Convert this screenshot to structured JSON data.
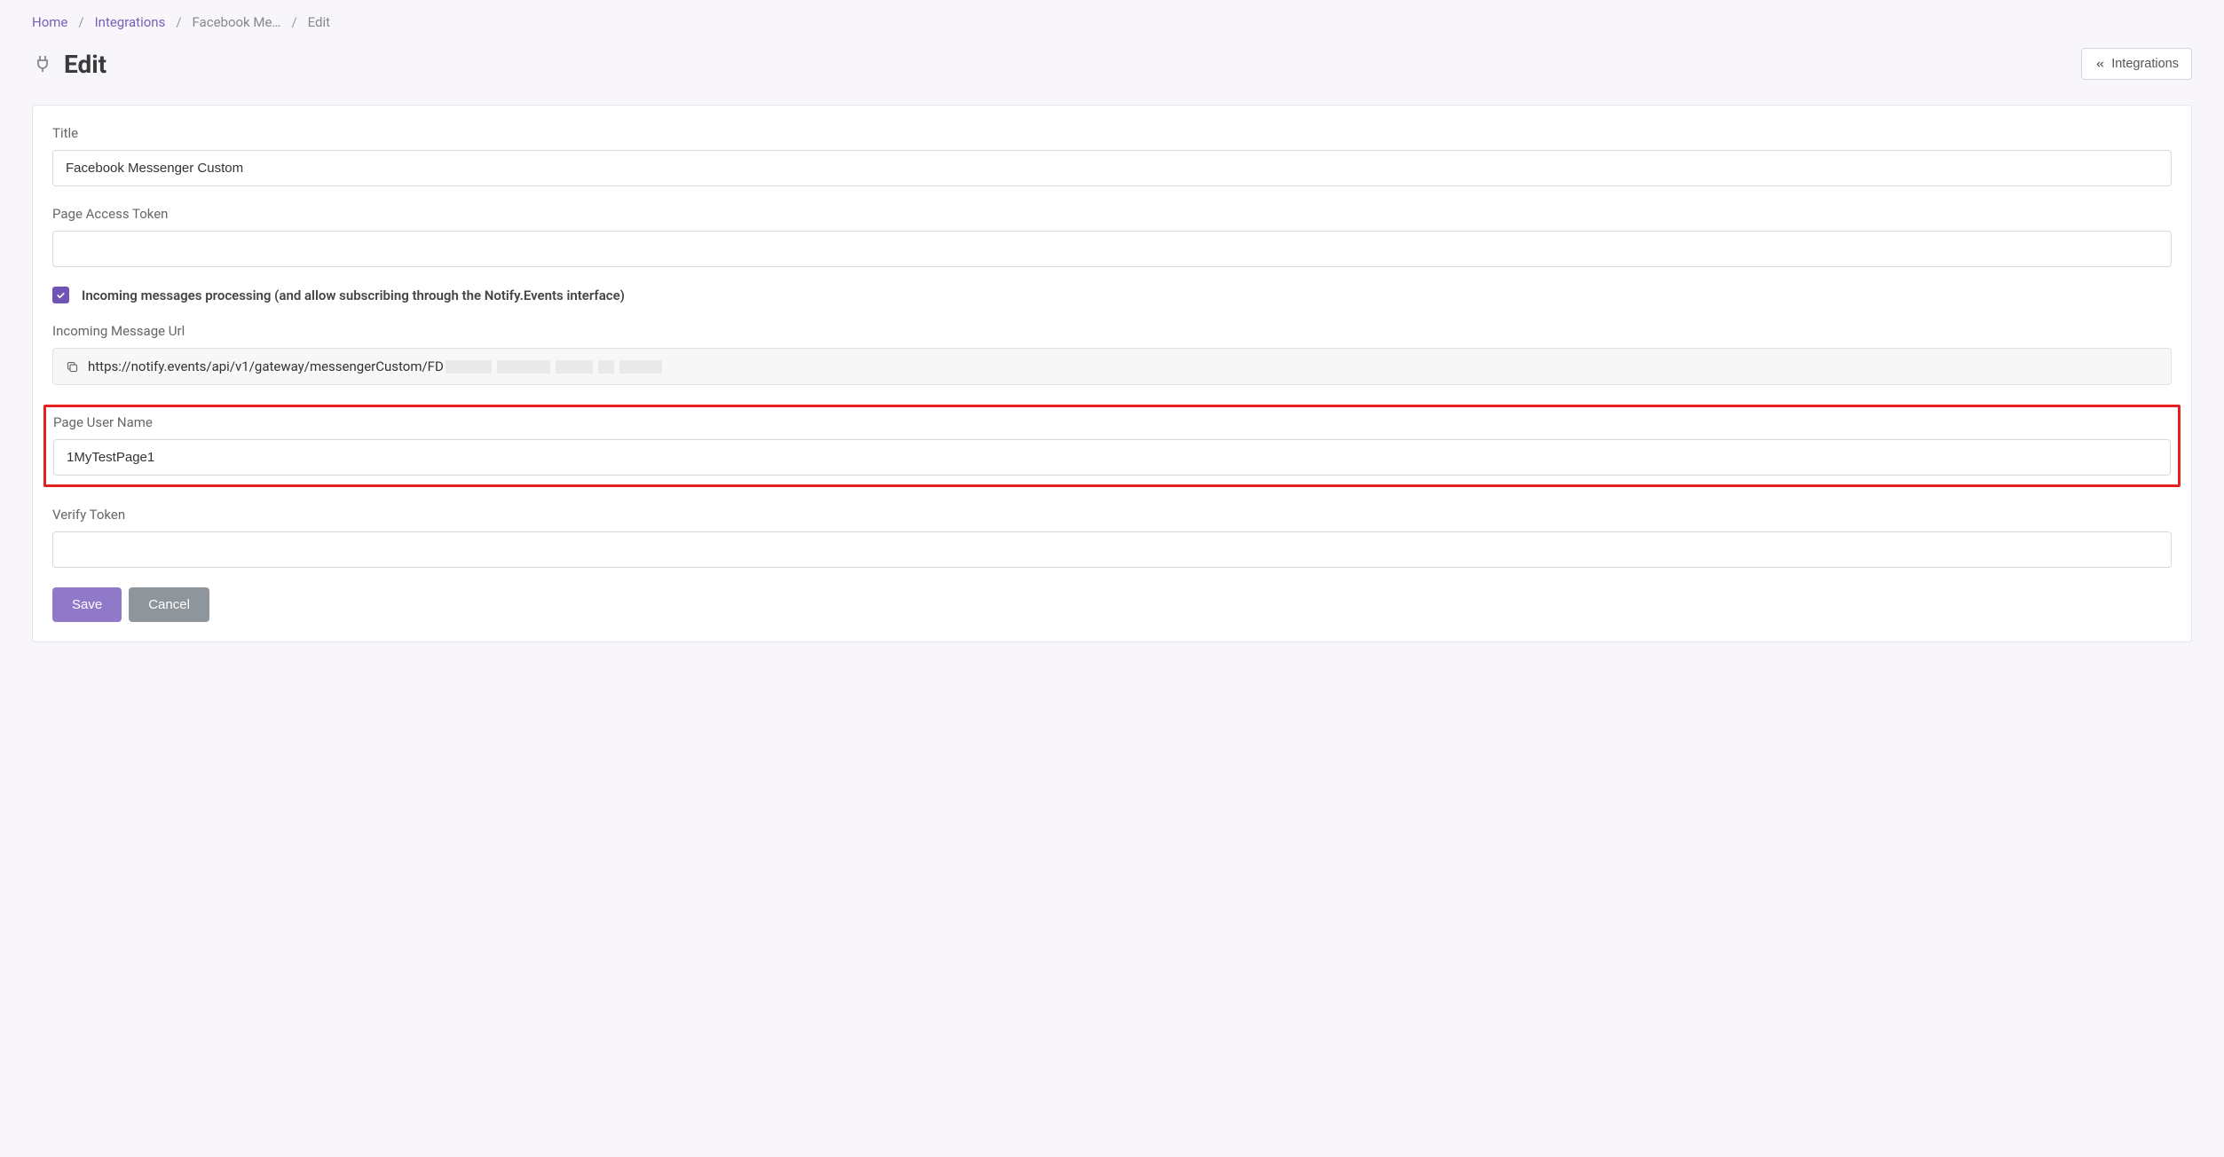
{
  "breadcrumb": {
    "home": "Home",
    "integrations": "Integrations",
    "provider": "Facebook Me…",
    "current": "Edit"
  },
  "header": {
    "title": "Edit",
    "back_button": "Integrations"
  },
  "form": {
    "title_label": "Title",
    "title_value": "Facebook Messenger Custom",
    "page_access_token_label": "Page Access Token",
    "page_access_token_value": "",
    "incoming_checkbox_label": "Incoming messages processing (and allow subscribing through the Notify.Events interface)",
    "incoming_url_label": "Incoming Message Url",
    "incoming_url_value": "https://notify.events/api/v1/gateway/messengerCustom/FD",
    "page_user_name_label": "Page User Name",
    "page_user_name_value": "1MyTestPage1",
    "verify_token_label": "Verify Token",
    "verify_token_value": "",
    "save_button": "Save",
    "cancel_button": "Cancel"
  }
}
